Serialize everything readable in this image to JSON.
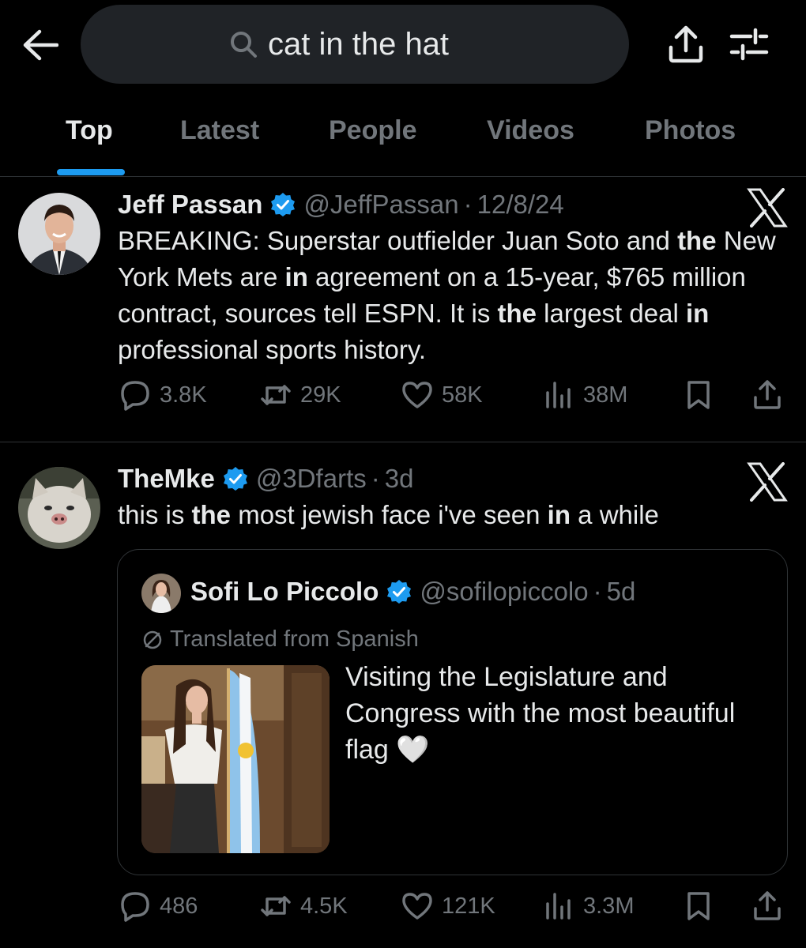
{
  "search": {
    "query": "cat in the hat"
  },
  "tabs": [
    {
      "label": "Top",
      "active": true
    },
    {
      "label": "Latest"
    },
    {
      "label": "People"
    },
    {
      "label": "Videos"
    },
    {
      "label": "Photos"
    }
  ],
  "tweets": [
    {
      "name": "Jeff Passan",
      "handle": "@JeffPassan",
      "sep": "·",
      "time": "12/8/24",
      "text_segments": [
        "BREAKING: Superstar outfielder Juan Soto and ",
        "the",
        " New York Mets are ",
        "in",
        " agreement on a 15-year, $765 million contract, sources tell ESPN. It is ",
        "the",
        " largest deal ",
        "in",
        " professional sports history."
      ],
      "stats": {
        "replies": "3.8K",
        "reposts": "29K",
        "likes": "58K",
        "views": "38M"
      }
    },
    {
      "name": "TheMke",
      "handle": "@3Dfarts",
      "sep": "·",
      "time": "3d",
      "text_segments": [
        "this is ",
        "the",
        " most jewish face i've seen ",
        "in",
        " a while"
      ],
      "quote": {
        "name": "Sofi Lo Piccolo",
        "handle": "@sofilopiccolo",
        "sep": "·",
        "time": "5d",
        "translated_label": "Translated from Spanish",
        "text": "Visiting the Legislature and Congress with the most beautiful flag",
        "emoji": "🤍"
      },
      "stats": {
        "replies": "486",
        "reposts": "4.5K",
        "likes": "121K",
        "views": "3.3M"
      }
    }
  ],
  "colors": {
    "accent": "#1d9bf0",
    "muted": "#71767b",
    "text": "#e7e9ea",
    "border": "#2f3336"
  },
  "icons": [
    "back-arrow-icon",
    "search-icon",
    "share-icon",
    "filter-icon",
    "verified-badge-icon",
    "x-logo-icon",
    "reply-icon",
    "repost-icon",
    "like-icon",
    "views-icon",
    "bookmark-icon",
    "translate-icon"
  ]
}
